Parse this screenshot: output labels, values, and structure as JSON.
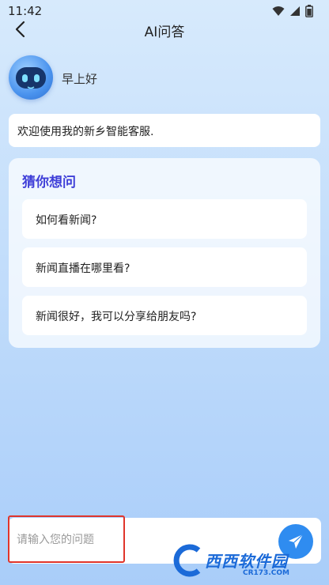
{
  "status_bar": {
    "time": "11:42"
  },
  "nav": {
    "title": "AI问答"
  },
  "greeting": {
    "text": "早上好"
  },
  "welcome": {
    "message": "欢迎使用我的新乡智能客服."
  },
  "guess": {
    "title": "猜你想问",
    "questions": [
      {
        "label": "如何看新闻?"
      },
      {
        "label": "新闻直播在哪里看?"
      },
      {
        "label": "新闻很好，我可以分享给朋友吗?"
      }
    ]
  },
  "input": {
    "placeholder": "请输入您的问题",
    "value": ""
  },
  "icons": {
    "back": "chevron-left-icon",
    "send": "paper-plane-icon",
    "wifi": "wifi-icon",
    "signal": "signal-icon",
    "battery": "battery-icon"
  },
  "watermark": {
    "brand": "西西软件园",
    "url": "CR173.COM"
  },
  "colors": {
    "accent": "#2f8cf0",
    "guess_title": "#3f3fd8",
    "highlight": "#e0352b"
  }
}
